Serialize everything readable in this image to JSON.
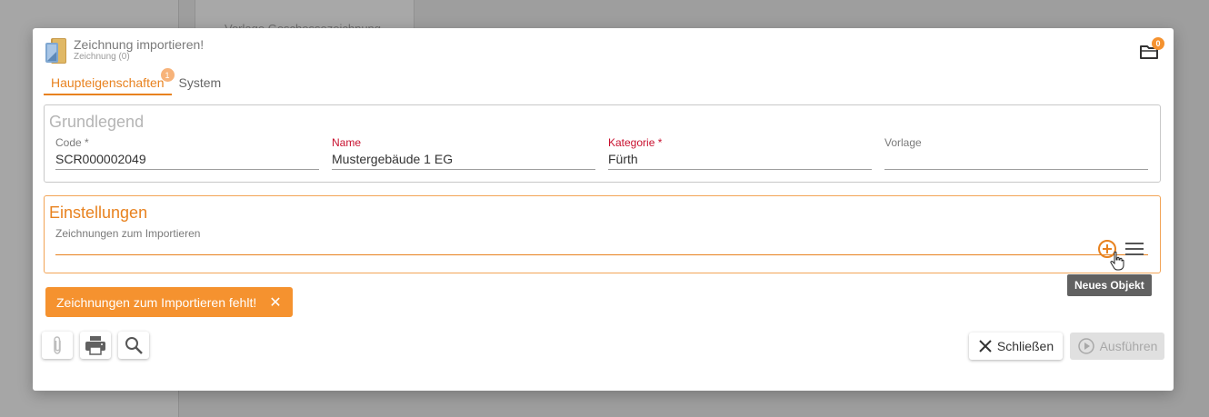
{
  "background": {
    "panel_text": "Vorlage Geschossezeichnung"
  },
  "dialog": {
    "title": "Zeichnung importieren!",
    "subtitle": "Zeichnung (0)",
    "folder_badge": "0"
  },
  "tabs": [
    {
      "label": "Haupteigenschaften",
      "badge": "1"
    },
    {
      "label": "System"
    }
  ],
  "grundlegend": {
    "title": "Grundlegend",
    "fields": {
      "code": {
        "label": "Code *",
        "value": "SCR000002049"
      },
      "name": {
        "label": "Name",
        "value": "Mustergebäude 1 EG"
      },
      "kategorie": {
        "label": "Kategorie *",
        "value": "Fürth"
      },
      "vorlage": {
        "label": "Vorlage",
        "value": ""
      }
    }
  },
  "einstellungen": {
    "title": "Einstellungen",
    "import_field": {
      "label": "Zeichnungen zum Importieren",
      "value": ""
    }
  },
  "tooltip": "Neues Objekt",
  "error_chip": {
    "text": "Zeichnungen zum Importieren fehlt!",
    "close": "✕"
  },
  "footer": {
    "close_label": "Schließen",
    "run_label": "Ausführen"
  },
  "colors": {
    "accent": "#e8821f",
    "error_chip": "#f5922f",
    "required_label": "#c8102e",
    "tooltip_bg": "#616161"
  }
}
